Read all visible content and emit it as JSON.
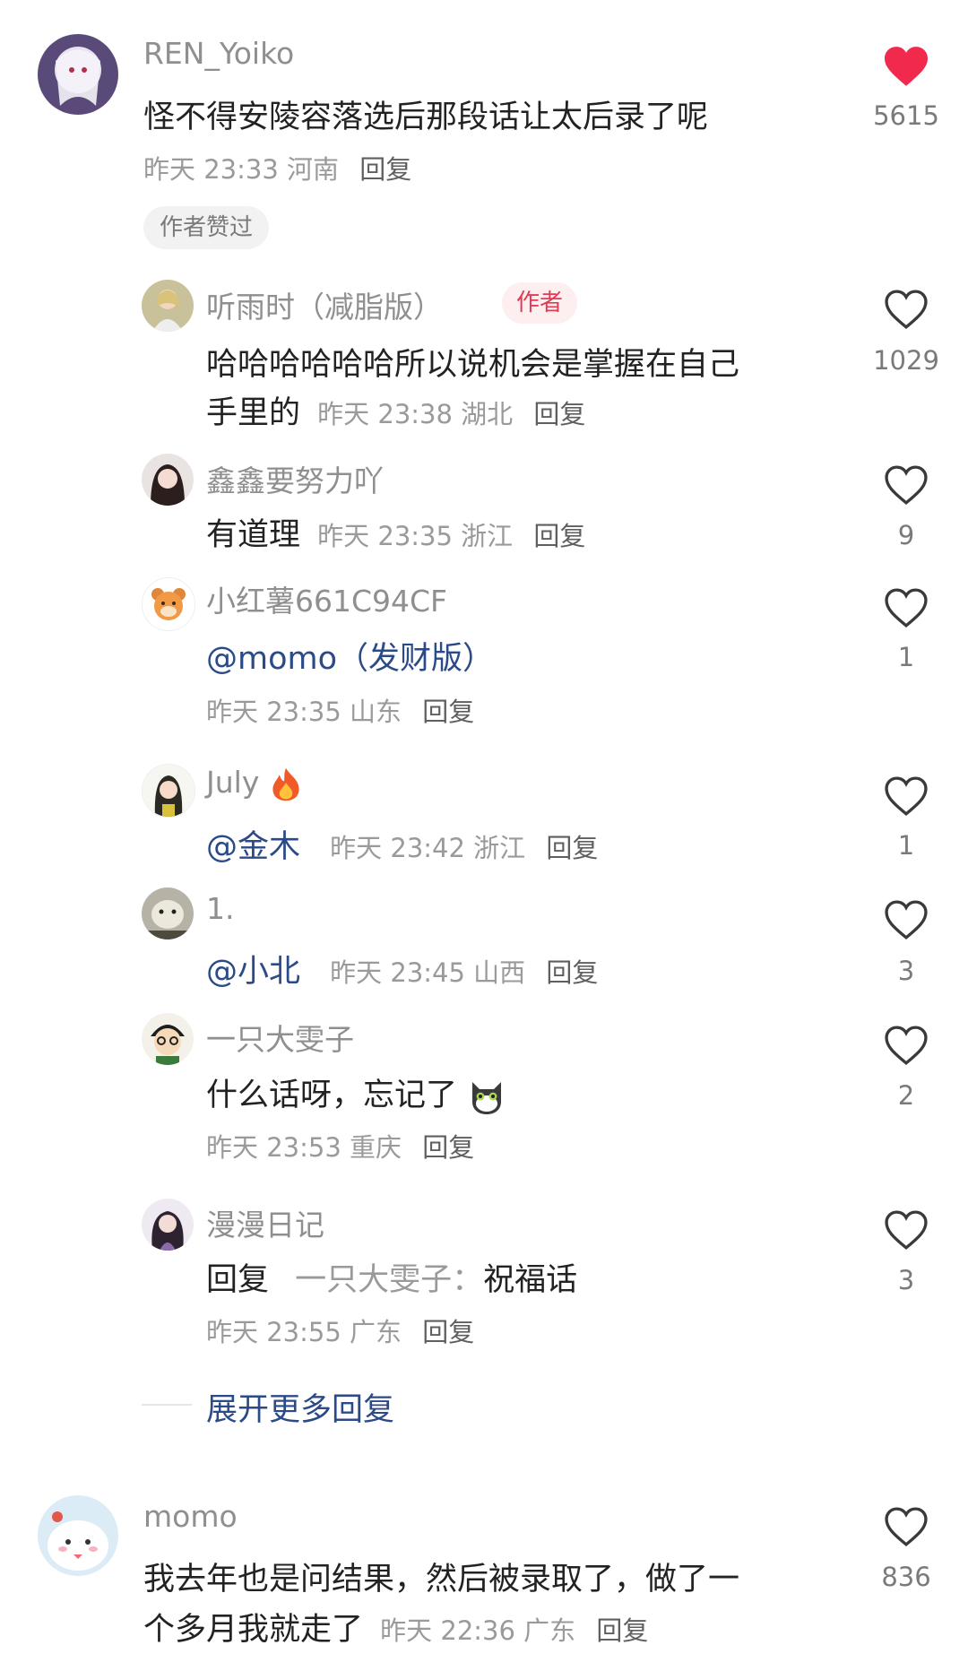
{
  "colors": {
    "liked_heart": "#f0294d",
    "mention": "#2b4a88",
    "author_badge_bg": "#fdeef0",
    "author_badge_text": "#e23b55"
  },
  "main_comment": {
    "username": "REN_Yoiko",
    "text": "怪不得安陵容落选后那段话让太后录了呢",
    "time": "昨天 23:33",
    "location": "河南",
    "reply_label": "回复",
    "like_count": "5615",
    "liked": true,
    "author_liked_badge": "作者赞过"
  },
  "replies": [
    {
      "username": "听雨时（减脂版）",
      "badge": "作者",
      "text_line1": "哈哈哈哈哈哈所以说机会是掌握在自己",
      "text_line2": "手里的",
      "time": "昨天 23:38",
      "location": "湖北",
      "reply_label": "回复",
      "like_count": "1029"
    },
    {
      "username": "鑫鑫要努力吖",
      "text": "有道理",
      "time": "昨天 23:35",
      "location": "浙江",
      "reply_label": "回复",
      "like_count": "9"
    },
    {
      "username": "小红薯661C94CF",
      "text": "@momo（发财版）",
      "time": "昨天 23:35",
      "location": "山东",
      "reply_label": "回复",
      "like_count": "1"
    },
    {
      "username": "July",
      "username_emoji": "fire-emoji",
      "text": "@金木",
      "time": "昨天 23:42",
      "location": "浙江",
      "reply_label": "回复",
      "like_count": "1"
    },
    {
      "username": "1.",
      "text": "@小北",
      "time": "昨天 23:45",
      "location": "山西",
      "reply_label": "回复",
      "like_count": "3"
    },
    {
      "username": "一只大雯子",
      "text": "什么话呀，忘记了",
      "text_emoji": "cat-emoji",
      "time": "昨天 23:53",
      "location": "重庆",
      "reply_label": "回复",
      "like_count": "2"
    },
    {
      "username": "漫漫日记",
      "reply_prefix": "回复",
      "reply_to": "一只大雯子：",
      "text": "祝福话",
      "time": "昨天 23:55",
      "location": "广东",
      "reply_label": "回复",
      "like_count": "3"
    }
  ],
  "expand_more": "展开更多回复",
  "next_comment": {
    "username": "momo",
    "text_line1": "我去年也是问结果，然后被录取了，做了一",
    "text_line2": "个多月我就走了",
    "time": "昨天 22:36",
    "location": "广东",
    "reply_label": "回复",
    "like_count": "836"
  }
}
